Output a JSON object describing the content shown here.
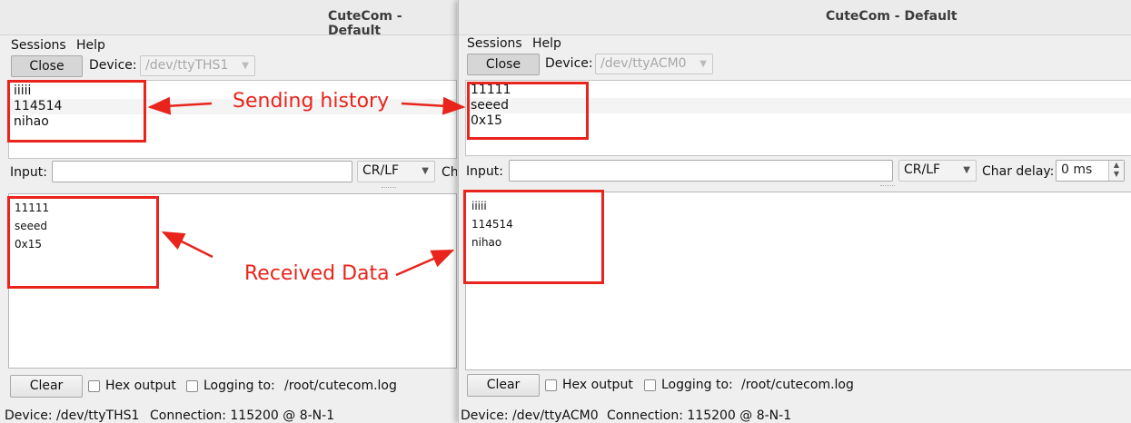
{
  "left_window": {
    "title": "CuteCom - Default",
    "menu": [
      "Sessions",
      "Help"
    ],
    "close_label": "Close",
    "device_label": "Device:",
    "device_value": "/dev/ttyTHS1",
    "history": [
      "iiiii",
      "114514",
      "nihao"
    ],
    "input_label": "Input:",
    "line_ending": "CR/LF",
    "char_delay_label_partial": "Ch",
    "received": [
      "11111",
      "seeed",
      "0x15"
    ],
    "clear_label": "Clear",
    "hex_output_label": "Hex output",
    "logging_label": "Logging to:",
    "logging_path": "/root/cutecom.log",
    "status_device": "Device:  /dev/ttyTHS1",
    "status_connection": "Connection:  115200 @ 8-N-1"
  },
  "right_window": {
    "title": "CuteCom - Default",
    "menu": [
      "Sessions",
      "Help"
    ],
    "close_label": "Close",
    "device_label": "Device:",
    "device_value": "/dev/ttyACM0",
    "history": [
      "11111",
      "seeed",
      "0x15"
    ],
    "input_label": "Input:",
    "line_ending": "CR/LF",
    "char_delay_label": "Char delay:",
    "char_delay_value": "0 ms",
    "received": [
      "iiiii",
      "114514",
      "nihao"
    ],
    "clear_label": "Clear",
    "hex_output_label": "Hex output",
    "logging_label": "Logging to:",
    "logging_path": "/root/cutecom.log",
    "status_device": "Device:  /dev/ttyACM0",
    "status_connection": "Connection:  115200 @ 8-N-1"
  },
  "annotations": {
    "sending_history": "Sending history",
    "received_data": "Received Data",
    "highlight_color": "#e8241c"
  }
}
